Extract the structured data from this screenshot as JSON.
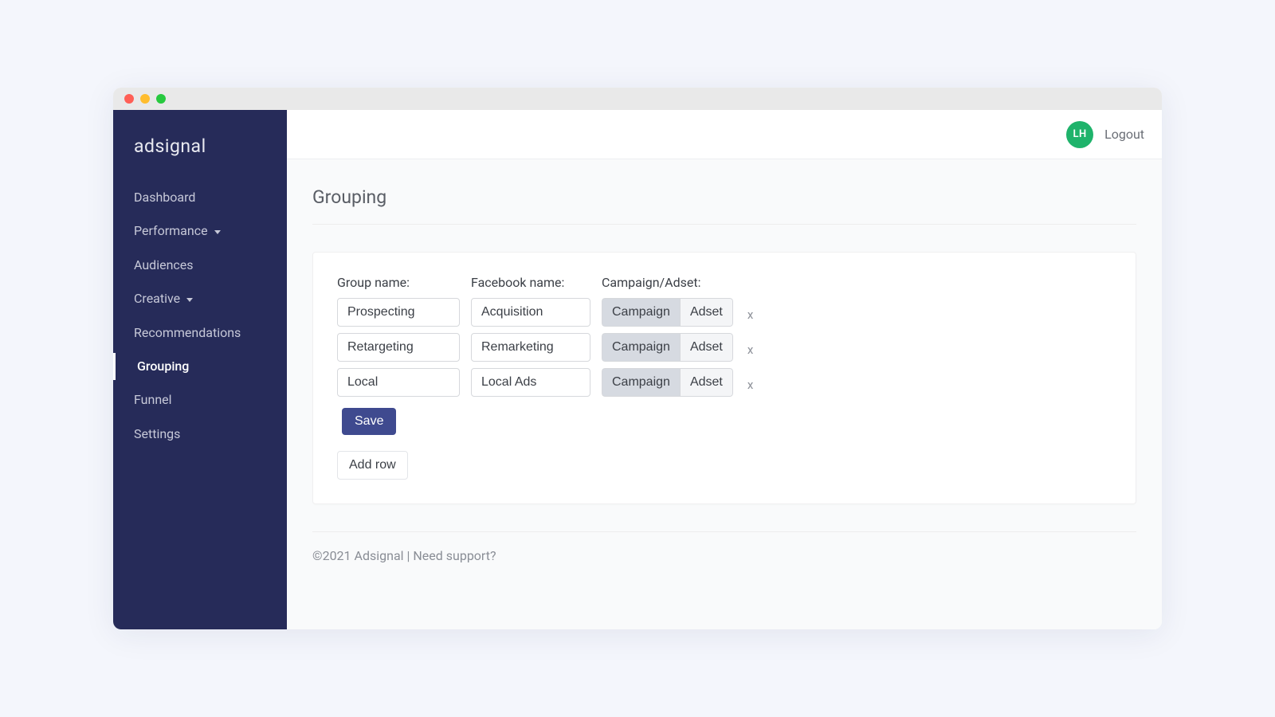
{
  "brand": "adsignal",
  "sidebar": {
    "items": [
      {
        "label": "Dashboard",
        "submenu": false,
        "active": false
      },
      {
        "label": "Performance",
        "submenu": true,
        "active": false
      },
      {
        "label": "Audiences",
        "submenu": false,
        "active": false
      },
      {
        "label": "Creative",
        "submenu": true,
        "active": false
      },
      {
        "label": "Recommendations",
        "submenu": false,
        "active": false
      },
      {
        "label": "Grouping",
        "submenu": false,
        "active": true
      },
      {
        "label": "Funnel",
        "submenu": false,
        "active": false
      },
      {
        "label": "Settings",
        "submenu": false,
        "active": false
      }
    ]
  },
  "topbar": {
    "avatar_initials": "LH",
    "logout_label": "Logout"
  },
  "page": {
    "title": "Grouping",
    "columns": {
      "group_name": "Group name:",
      "facebook_name": "Facebook name:",
      "campaign_adset": "Campaign/Adset:"
    },
    "toggle_options": {
      "campaign": "Campaign",
      "adset": "Adset"
    },
    "rows": [
      {
        "group_name": "Prospecting",
        "facebook_name": "Acquisition",
        "selected": "campaign"
      },
      {
        "group_name": "Retargeting",
        "facebook_name": "Remarketing",
        "selected": "campaign"
      },
      {
        "group_name": "Local",
        "facebook_name": "Local Ads",
        "selected": "campaign"
      }
    ],
    "delete_label": "x",
    "save_label": "Save",
    "add_row_label": "Add row"
  },
  "footer": {
    "text": "©2021 Adsignal | Need support?"
  }
}
